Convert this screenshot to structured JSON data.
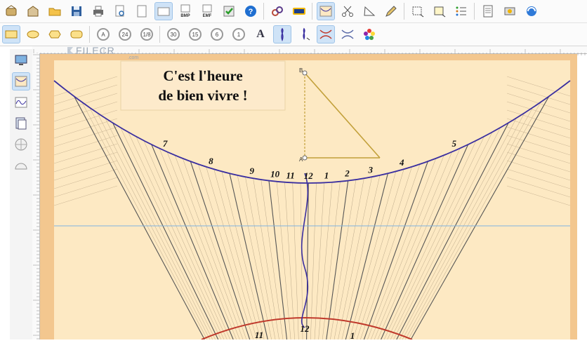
{
  "toolbar1": {
    "bmp_label_1": "BMP",
    "bmp_label_2": "EMF"
  },
  "toolbar2": {
    "clocks": [
      "A",
      "24",
      "1/8",
      "30",
      "15",
      "6",
      "1"
    ],
    "text_tool": "A"
  },
  "watermark": {
    "text": "FILECR",
    "sub": ".com"
  },
  "dial": {
    "motto_line1": "C'est l'heure",
    "motto_line2": "de bien vivre !",
    "gnomon_top_label": "B",
    "gnomon_bottom_label": "A",
    "hour_labels_upper": [
      "7",
      "8",
      "9",
      "10",
      "11",
      "12",
      "1",
      "2",
      "3",
      "4",
      "5"
    ],
    "hour_labels_lower": [
      "11",
      "12",
      "1"
    ]
  },
  "colors": {
    "dial_background": "#fde9c3",
    "dial_border": "#f3c78f",
    "hour_curve": "#3a2fa0",
    "lower_curve": "#c0392b",
    "gnomon": "#c2a03a",
    "equinox_line": "#7fb2e0"
  }
}
